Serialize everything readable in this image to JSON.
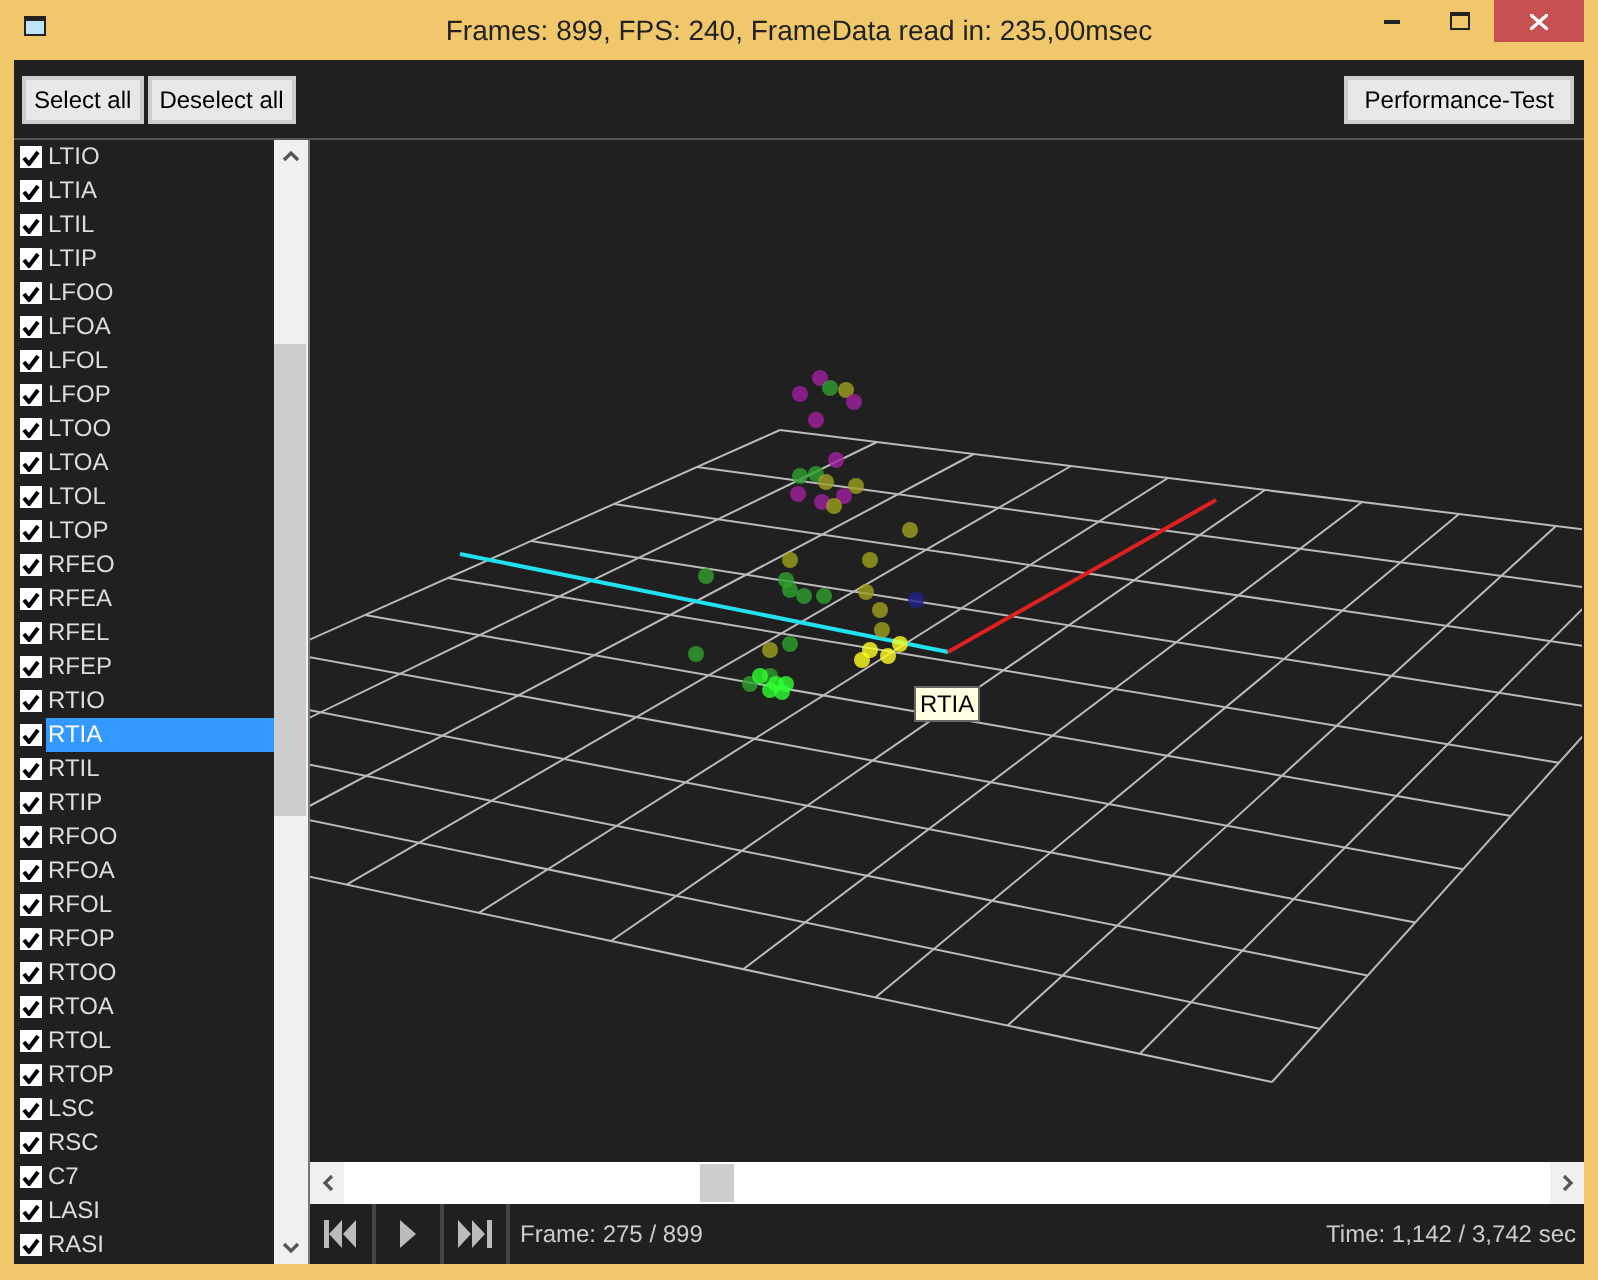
{
  "window": {
    "title": "Frames: 899, FPS: 240, FrameData read in: 235,00msec"
  },
  "toolbar": {
    "buttons": [
      "Select all",
      "Deselect all"
    ],
    "performance_button": "Performance-Test"
  },
  "markers": [
    {
      "label": "LTIO",
      "checked": true,
      "selected": false
    },
    {
      "label": "LTIA",
      "checked": true,
      "selected": false
    },
    {
      "label": "LTIL",
      "checked": true,
      "selected": false
    },
    {
      "label": "LTIP",
      "checked": true,
      "selected": false
    },
    {
      "label": "LFOO",
      "checked": true,
      "selected": false
    },
    {
      "label": "LFOA",
      "checked": true,
      "selected": false
    },
    {
      "label": "LFOL",
      "checked": true,
      "selected": false
    },
    {
      "label": "LFOP",
      "checked": true,
      "selected": false
    },
    {
      "label": "LTOO",
      "checked": true,
      "selected": false
    },
    {
      "label": "LTOA",
      "checked": true,
      "selected": false
    },
    {
      "label": "LTOL",
      "checked": true,
      "selected": false
    },
    {
      "label": "LTOP",
      "checked": true,
      "selected": false
    },
    {
      "label": "RFEO",
      "checked": true,
      "selected": false
    },
    {
      "label": "RFEA",
      "checked": true,
      "selected": false
    },
    {
      "label": "RFEL",
      "checked": true,
      "selected": false
    },
    {
      "label": "RFEP",
      "checked": true,
      "selected": false
    },
    {
      "label": "RTIO",
      "checked": true,
      "selected": false
    },
    {
      "label": "RTIA",
      "checked": true,
      "selected": true
    },
    {
      "label": "RTIL",
      "checked": true,
      "selected": false
    },
    {
      "label": "RTIP",
      "checked": true,
      "selected": false
    },
    {
      "label": "RFOO",
      "checked": true,
      "selected": false
    },
    {
      "label": "RFOA",
      "checked": true,
      "selected": false
    },
    {
      "label": "RFOL",
      "checked": true,
      "selected": false
    },
    {
      "label": "RFOP",
      "checked": true,
      "selected": false
    },
    {
      "label": "RTOO",
      "checked": true,
      "selected": false
    },
    {
      "label": "RTOA",
      "checked": true,
      "selected": false
    },
    {
      "label": "RTOL",
      "checked": true,
      "selected": false
    },
    {
      "label": "RTOP",
      "checked": true,
      "selected": false
    },
    {
      "label": "LSC",
      "checked": true,
      "selected": false
    },
    {
      "label": "RSC",
      "checked": true,
      "selected": false
    },
    {
      "label": "C7",
      "checked": true,
      "selected": false
    },
    {
      "label": "LASI",
      "checked": true,
      "selected": false
    },
    {
      "label": "RASI",
      "checked": true,
      "selected": false
    }
  ],
  "viewport": {
    "tooltip": "RTIA"
  },
  "playback": {
    "frame": "Frame: 275 / 899",
    "time": "Time: 1,142 / 3,742 sec"
  }
}
